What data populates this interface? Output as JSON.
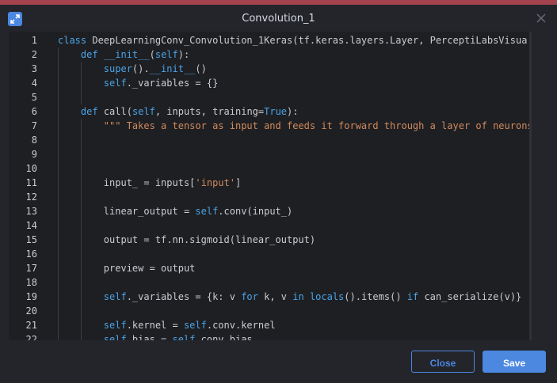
{
  "window": {
    "title": "Convolution_1",
    "accent": "#4c87e0"
  },
  "editor": {
    "lines": [
      {
        "n": "1",
        "parts": [
          {
            "t": "class ",
            "c": "kw"
          },
          {
            "t": "DeepLearningConv_Convolution_1Keras(tf.keras.layers.Layer, PerceptiLabsVisua"
          }
        ]
      },
      {
        "n": "2",
        "parts": [
          {
            "t": "    "
          },
          {
            "t": "def ",
            "c": "kw"
          },
          {
            "t": "__init__",
            "c": "kw"
          },
          {
            "t": "("
          },
          {
            "t": "self",
            "c": "kw"
          },
          {
            "t": "):"
          }
        ]
      },
      {
        "n": "3",
        "parts": [
          {
            "t": "        "
          },
          {
            "t": "super",
            "c": "kw"
          },
          {
            "t": "()."
          },
          {
            "t": "__init__",
            "c": "kw"
          },
          {
            "t": "()"
          }
        ]
      },
      {
        "n": "4",
        "parts": [
          {
            "t": "        "
          },
          {
            "t": "self",
            "c": "kw"
          },
          {
            "t": "._variables = {}"
          }
        ]
      },
      {
        "n": "5",
        "parts": []
      },
      {
        "n": "6",
        "parts": [
          {
            "t": "    "
          },
          {
            "t": "def ",
            "c": "kw"
          },
          {
            "t": "call("
          },
          {
            "t": "self",
            "c": "kw"
          },
          {
            "t": ", inputs, training="
          },
          {
            "t": "True",
            "c": "kw"
          },
          {
            "t": "):"
          }
        ]
      },
      {
        "n": "7",
        "parts": [
          {
            "t": "        "
          },
          {
            "t": "\"\"\" Takes a tensor as input and feeds it forward through a layer of neurons",
            "c": "str"
          }
        ]
      },
      {
        "n": "8",
        "parts": []
      },
      {
        "n": "9",
        "parts": []
      },
      {
        "n": "10",
        "parts": []
      },
      {
        "n": "11",
        "parts": [
          {
            "t": "        input_ = inputs["
          },
          {
            "t": "'input'",
            "c": "str"
          },
          {
            "t": "]"
          }
        ]
      },
      {
        "n": "12",
        "parts": []
      },
      {
        "n": "13",
        "parts": [
          {
            "t": "        linear_output = "
          },
          {
            "t": "self",
            "c": "kw"
          },
          {
            "t": ".conv(input_)"
          }
        ]
      },
      {
        "n": "14",
        "parts": []
      },
      {
        "n": "15",
        "parts": [
          {
            "t": "        output = tf.nn.sigmoid(linear_output)"
          }
        ]
      },
      {
        "n": "16",
        "parts": []
      },
      {
        "n": "17",
        "parts": [
          {
            "t": "        preview = output"
          }
        ]
      },
      {
        "n": "18",
        "parts": []
      },
      {
        "n": "19",
        "parts": [
          {
            "t": "        "
          },
          {
            "t": "self",
            "c": "kw"
          },
          {
            "t": "._variables = {k: v "
          },
          {
            "t": "for",
            "c": "kw"
          },
          {
            "t": " k, v "
          },
          {
            "t": "in",
            "c": "kw"
          },
          {
            "t": " "
          },
          {
            "t": "locals",
            "c": "kw"
          },
          {
            "t": "().items() "
          },
          {
            "t": "if",
            "c": "kw"
          },
          {
            "t": " can_serialize(v)}"
          }
        ]
      },
      {
        "n": "20",
        "parts": []
      },
      {
        "n": "21",
        "parts": [
          {
            "t": "        "
          },
          {
            "t": "self",
            "c": "kw"
          },
          {
            "t": ".kernel = "
          },
          {
            "t": "self",
            "c": "kw"
          },
          {
            "t": ".conv.kernel"
          }
        ]
      },
      {
        "n": "22",
        "parts": [
          {
            "t": "        "
          },
          {
            "t": "self",
            "c": "kw"
          },
          {
            "t": ".bias = "
          },
          {
            "t": "self",
            "c": "kw"
          },
          {
            "t": ".conv.bias"
          }
        ]
      }
    ]
  },
  "footer": {
    "close_label": "Close",
    "save_label": "Save"
  }
}
